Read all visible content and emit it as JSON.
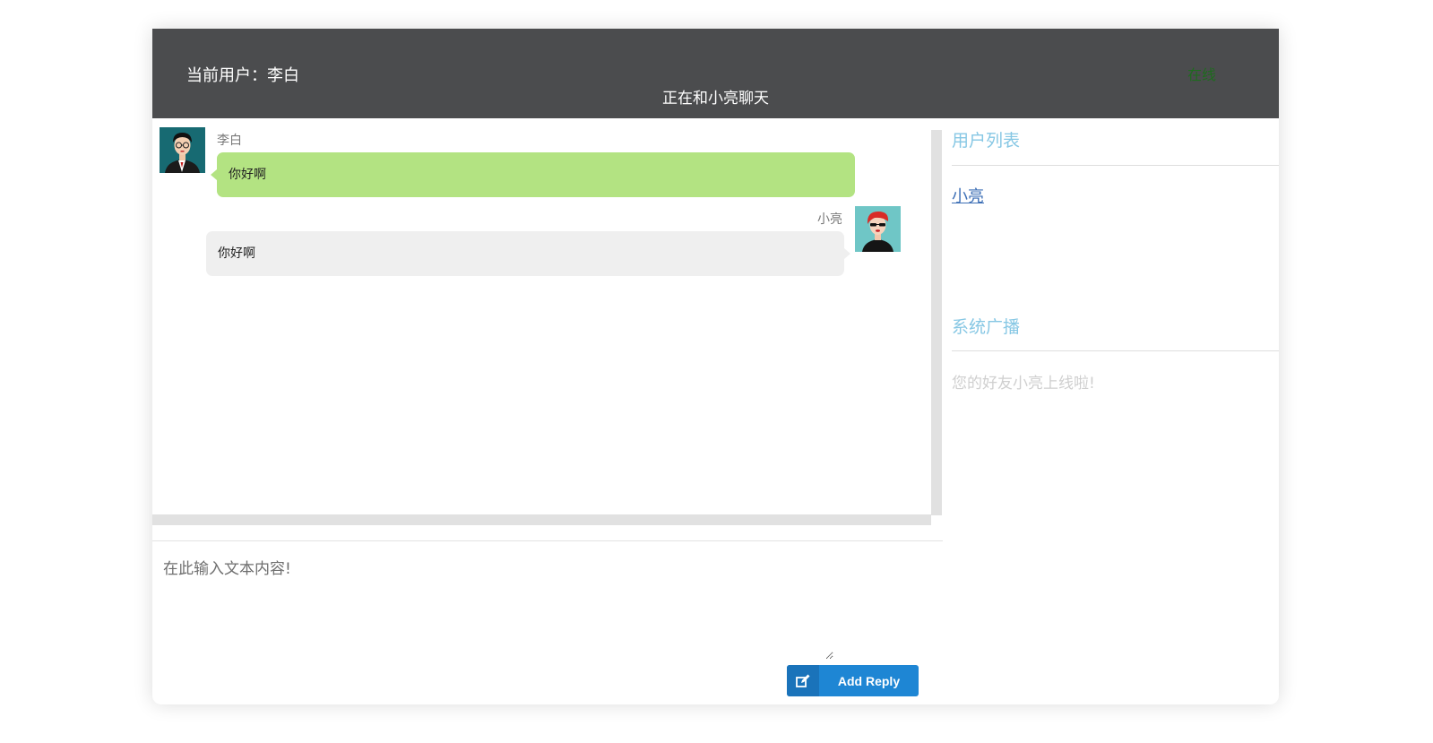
{
  "header": {
    "current_user": "当前用户：李白",
    "chat_title": "正在和小亮聊天",
    "status": "在线"
  },
  "messages": [
    {
      "sender": "李白",
      "text": "你好啊",
      "side": "left",
      "bubble_color": "#b3e382"
    },
    {
      "sender": "小亮",
      "text": "你好啊",
      "side": "right",
      "bubble_color": "#efefef"
    }
  ],
  "reply": {
    "placeholder": "在此输入文本内容!",
    "button_label": "Add Reply",
    "button_icon": "edit-icon"
  },
  "sidebar": {
    "users_title": "用户列表",
    "users": [
      "小亮"
    ],
    "broadcast_title": "系统广播",
    "broadcasts": [
      "您的好友小亮上线啦!"
    ]
  },
  "colors": {
    "header_bg": "#4b4c4e",
    "accent_blue": "#1e86d4",
    "panel_title": "#86c7e4",
    "online_green": "#1e6b1e"
  }
}
